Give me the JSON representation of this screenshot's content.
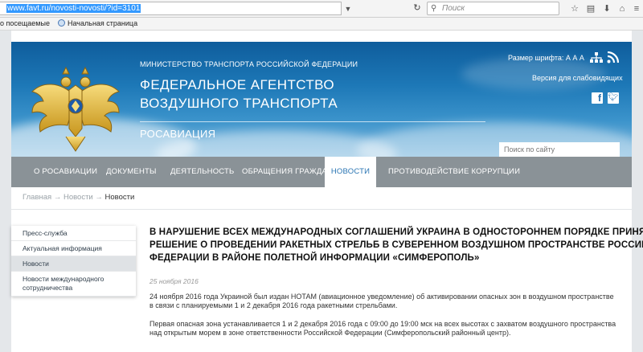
{
  "browser": {
    "url": "www.favt.ru/novosti-novosti/?id=3101",
    "search_placeholder": "Поиск",
    "bookmarks": [
      "о посещаемые",
      "Начальная страница"
    ]
  },
  "header": {
    "ministry": "МИНИСТЕРСТВО ТРАНСПОРТА РОССИЙСКОЙ ФЕДЕРАЦИИ",
    "agency_line1": "ФЕДЕРАЛЬНОЕ АГЕНТСТВО",
    "agency_line2": "ВОЗДУШНОГО ТРАНСПОРТА",
    "short_name": "РОСАВИАЦИЯ",
    "font_size_label": "Размер шрифта: А А А",
    "low_vision_link": "Версия для слабовидящих",
    "search_placeholder": "Поиск по сайту"
  },
  "nav": {
    "items": [
      {
        "label": "О РОСАВИАЦИИ"
      },
      {
        "label": "ДОКУМЕНТЫ"
      },
      {
        "label": "ДЕЯТЕЛЬНОСТЬ"
      },
      {
        "label": "ОБРАЩЕНИЯ ГРАЖДАН"
      },
      {
        "label": "НОВОСТИ"
      },
      {
        "label": "ПРОТИВОДЕЙСТВИЕ КОРРУПЦИИ"
      }
    ],
    "active_index": 4
  },
  "breadcrumb": {
    "home": "Главная",
    "section": "Новости",
    "current": "Новости",
    "separator": "→"
  },
  "sidebar": {
    "items": [
      {
        "label": "Пресс-служба"
      },
      {
        "label": "Актуальная информация"
      },
      {
        "label": "Новости"
      },
      {
        "label_line1": "Новости международного",
        "label_line2": "сотрудничества"
      }
    ]
  },
  "article": {
    "title_lines": [
      "В НАРУШЕНИЕ ВСЕХ МЕЖДУНАРОДНЫХ СОГЛАШЕНИЙ УКРАИНА В ОДНОСТОРОННЕМ ПОРЯДКЕ ПРИНЯЛА",
      "РЕШЕНИЕ О ПРОВЕДЕНИИ РАКЕТНЫХ СТРЕЛЬБ В СУВЕРЕННОМ ВОЗДУШНОМ ПРОСТРАНСТВЕ РОССИЙСКОЙ",
      "ФЕДЕРАЦИИ В РАЙОНЕ ПОЛЕТНОЙ ИНФОРМАЦИИ «СИМФЕРОПОЛЬ»"
    ],
    "date": "25 ноября 2016",
    "paragraph1_lines": [
      "24 ноября 2016 года Украиной был издан НОТАМ (авиационное уведомление) об активировании опасных зон в воздушном пространстве",
      "в связи с планируемыми 1 и 2 декабря 2016 года ракетными стрельбами."
    ],
    "paragraph2_lines": [
      "Первая опасная зона устанавливается 1 и 2 декабря 2016 года с 09:00 до 19:00 мск на всех высотах с захватом воздушного пространства",
      "над открытым морем в зоне ответственности Российской Федерации (Симферопольский районный центр)."
    ]
  },
  "icons": {
    "search": "search-icon",
    "reload": "reload-icon",
    "sitemap": "sitemap-icon",
    "rss": "rss-icon",
    "facebook": "facebook-icon",
    "twitter": "twitter-icon"
  },
  "colors": {
    "header_blue": "#1d78b7",
    "nav_gray": "#8a9297",
    "active_nav_text": "#2a75b3"
  }
}
